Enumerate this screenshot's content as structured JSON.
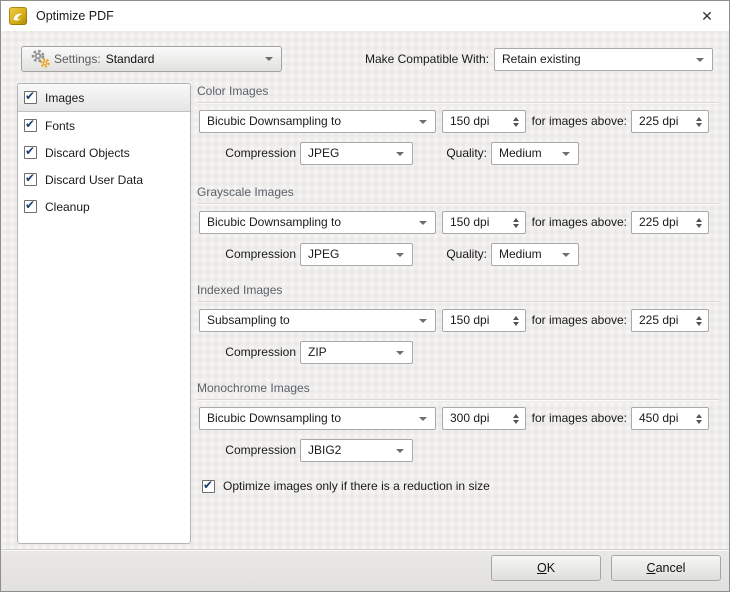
{
  "window": {
    "title": "Optimize PDF",
    "close_glyph": "✕"
  },
  "toolbar": {
    "settings_label": "Settings:",
    "settings_value": "Standard",
    "compat_label": "Make Compatible With:",
    "compat_value": "Retain existing"
  },
  "sidebar": {
    "items": [
      {
        "label": "Images",
        "checked": true,
        "selected": true
      },
      {
        "label": "Fonts",
        "checked": true,
        "selected": false
      },
      {
        "label": "Discard Objects",
        "checked": true,
        "selected": false
      },
      {
        "label": "Discard User Data",
        "checked": true,
        "selected": false
      },
      {
        "label": "Cleanup",
        "checked": true,
        "selected": false
      }
    ]
  },
  "sections": [
    {
      "title": "Color Images",
      "downsample": "Bicubic Downsampling to",
      "dpi": "150 dpi",
      "above_label": "for images above:",
      "above": "225 dpi",
      "compression_label": "Compression",
      "compression": "JPEG",
      "quality_label": "Quality:",
      "quality": "Medium"
    },
    {
      "title": "Grayscale Images",
      "downsample": "Bicubic Downsampling to",
      "dpi": "150 dpi",
      "above_label": "for images above:",
      "above": "225 dpi",
      "compression_label": "Compression",
      "compression": "JPEG",
      "quality_label": "Quality:",
      "quality": "Medium"
    },
    {
      "title": "Indexed Images",
      "downsample": "Subsampling to",
      "dpi": "150 dpi",
      "above_label": "for images above:",
      "above": "225 dpi",
      "compression_label": "Compression",
      "compression": "ZIP"
    },
    {
      "title": "Monochrome Images",
      "downsample": "Bicubic Downsampling to",
      "dpi": "300 dpi",
      "above_label": "for images above:",
      "above": "450 dpi",
      "compression_label": "Compression",
      "compression": "JBIG2"
    }
  ],
  "footer_option": {
    "label": "Optimize images only if there is a reduction in size",
    "checked": true
  },
  "buttons": {
    "ok": "OK",
    "cancel": "Cancel"
  },
  "colors": {
    "accent_gold": "#d9af17",
    "check_blue": "#1d3f74",
    "section_title": "#5a6168"
  },
  "icons": {
    "check": "✔"
  }
}
